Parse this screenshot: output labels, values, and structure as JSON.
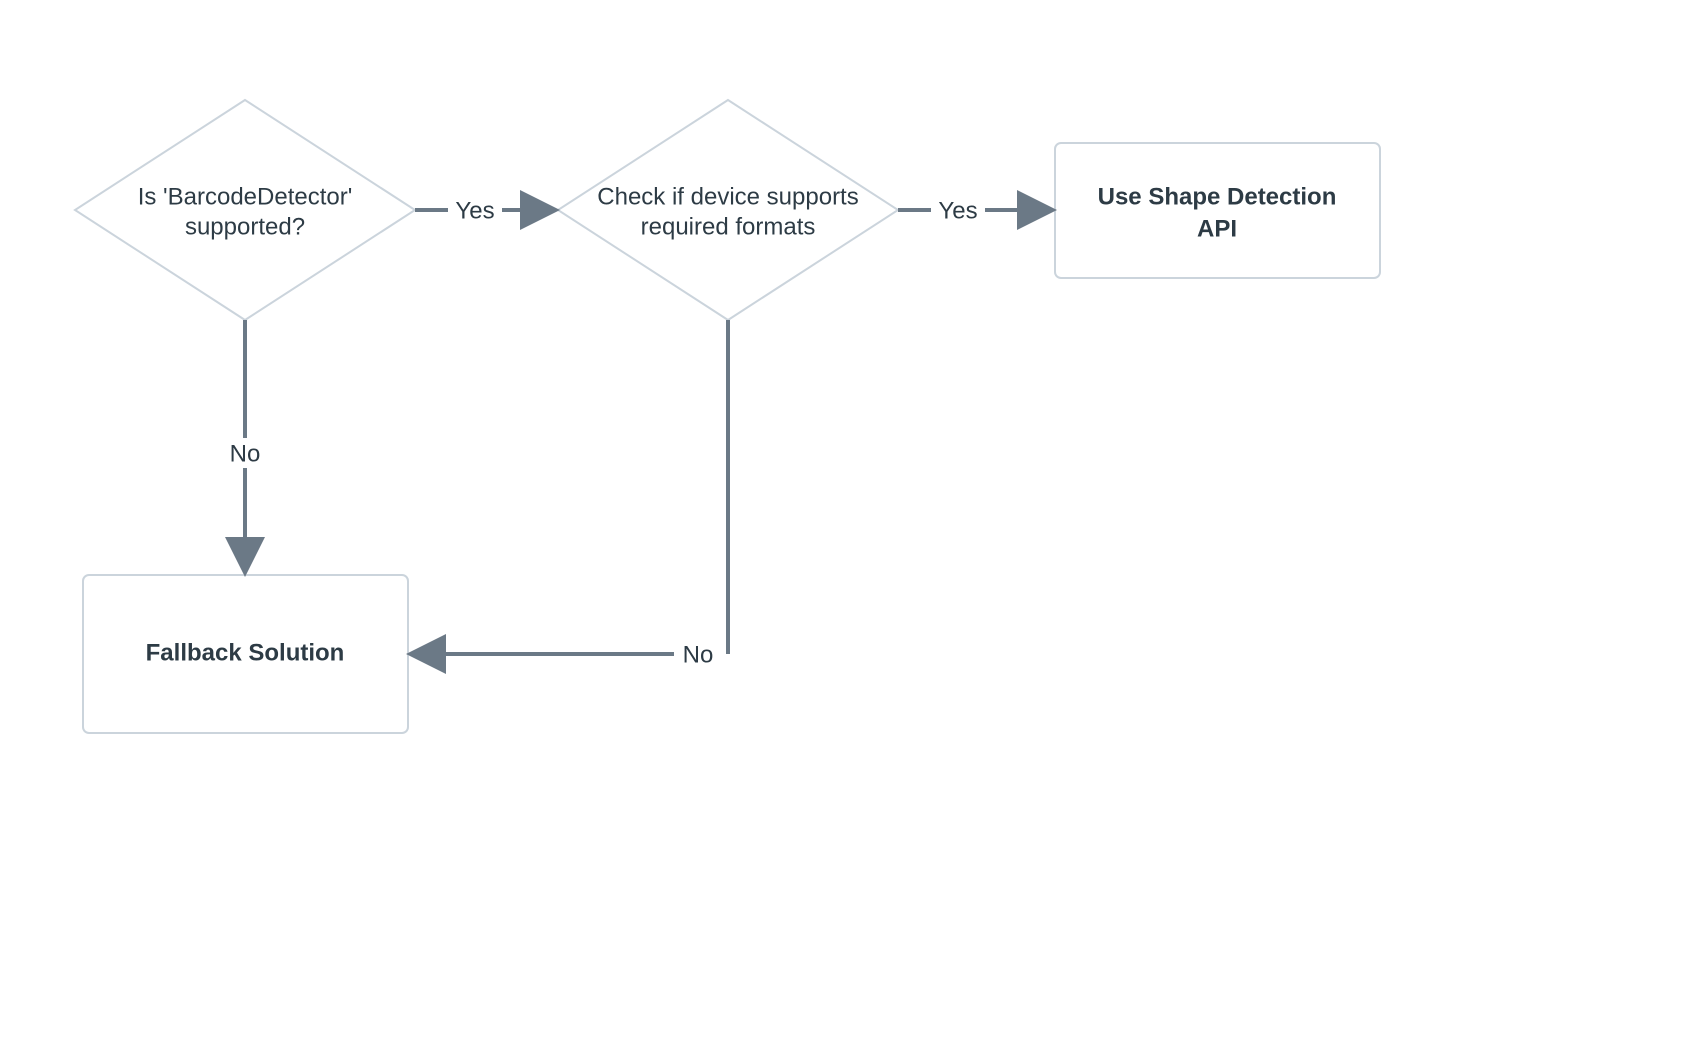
{
  "diagram": {
    "nodes": {
      "decision1": {
        "line1": "Is 'BarcodeDetector'",
        "line2": "supported?"
      },
      "decision2": {
        "line1": "Check if device supports",
        "line2": "required formats"
      },
      "result_api": {
        "line1": "Use Shape Detection",
        "line2": "API"
      },
      "result_fallback": {
        "label": "Fallback Solution"
      }
    },
    "edges": {
      "d1_yes": "Yes",
      "d1_no": "No",
      "d2_yes": "Yes",
      "d2_no": "No"
    },
    "style": {
      "stroke": "#cbd4dc",
      "arrow": "#6b7986",
      "text": "#2d3b45"
    }
  }
}
